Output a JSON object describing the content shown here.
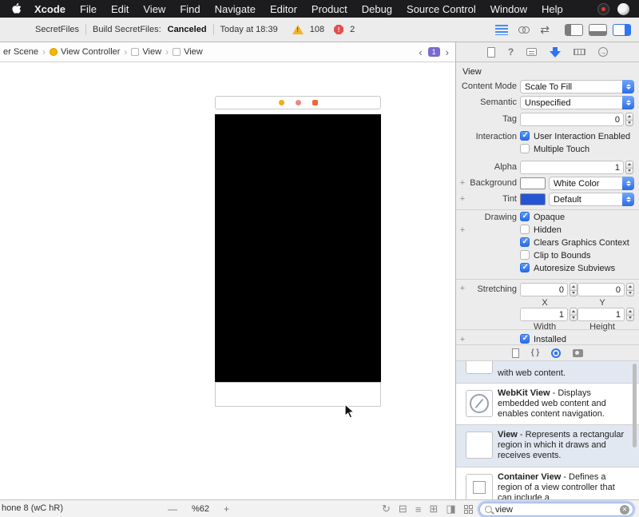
{
  "menubar": {
    "app_name": "Xcode",
    "items": [
      "File",
      "Edit",
      "View",
      "Find",
      "Navigate",
      "Editor",
      "Product",
      "Debug",
      "Source Control",
      "Window",
      "Help"
    ]
  },
  "toolbar": {
    "project": "SecretFiles",
    "status_text": "Build SecretFiles:",
    "status_result": "Canceled",
    "time": "Today at 18:39",
    "warning_count": "108",
    "error_count": "2"
  },
  "jumpbar": {
    "crumb_scene": "er Scene",
    "crumb_controller": "View Controller",
    "crumb_view1": "View",
    "crumb_view2": "View",
    "back_arrow": "‹",
    "forward_arrow": "›",
    "chevron": "›",
    "page_badge": "1"
  },
  "inspector": {
    "title": "View",
    "plus": "+",
    "content_mode_label": "Content Mode",
    "content_mode_value": "Scale To Fill",
    "semantic_label": "Semantic",
    "semantic_value": "Unspecified",
    "tag_label": "Tag",
    "tag_value": "0",
    "interaction_label": "Interaction",
    "interaction_cb1": "User Interaction Enabled",
    "interaction_cb1_checked": true,
    "interaction_cb2": "Multiple Touch",
    "interaction_cb2_checked": false,
    "alpha_label": "Alpha",
    "alpha_value": "1",
    "background_label": "Background",
    "background_value": "White Color",
    "background_swatch": "#ffffff",
    "tint_label": "Tint",
    "tint_value": "Default",
    "tint_swatch": "#2456d4",
    "drawing_label": "Drawing",
    "drawing": [
      {
        "label": "Opaque",
        "checked": true
      },
      {
        "label": "Hidden",
        "checked": false
      },
      {
        "label": "Clears Graphics Context",
        "checked": true
      },
      {
        "label": "Clip to Bounds",
        "checked": false
      },
      {
        "label": "Autoresize Subviews",
        "checked": true
      }
    ],
    "stretching_label": "Stretching",
    "stretch_x": "0",
    "stretch_y": "0",
    "stretch_w": "1",
    "stretch_h": "1",
    "stretch_x_label": "X",
    "stretch_y_label": "Y",
    "stretch_w_label": "Width",
    "stretch_h_label": "Height",
    "installed_label": "Installed",
    "installed_checked": true,
    "help_icon": "?",
    "connections_icon": "→"
  },
  "library": {
    "items": [
      {
        "name": "",
        "desc": "with web content."
      },
      {
        "name": "WebKit View",
        "desc": " - Displays embedded web content and enables content navigation."
      },
      {
        "name": "View",
        "desc": " - Represents a rectangular region in which it draws and receives events."
      },
      {
        "name": "Container View",
        "desc": " - Defines a region of a view controller that can include a"
      }
    ],
    "braces_icon": "{ }"
  },
  "statusbar": {
    "device": "hone 8 (wC hR)",
    "zoom_out": "—",
    "zoom_level": "%62",
    "zoom_in": "+",
    "filter_value": "view",
    "clear_icon": "✕"
  },
  "icons": {
    "editor_arrows": "⇄",
    "update_frames": "↻",
    "embed": "⊟",
    "align": "≡",
    "constraints": "⊞",
    "resolve": "◨"
  },
  "colors": {
    "accent_blue": "#2f74f0",
    "warning_yellow": "#f2b32a",
    "error_red": "#e14f4f",
    "dot_yellow": "#f3ac15",
    "dot_salmon": "#ef8585",
    "dot_orange": "#ed6a2f"
  }
}
